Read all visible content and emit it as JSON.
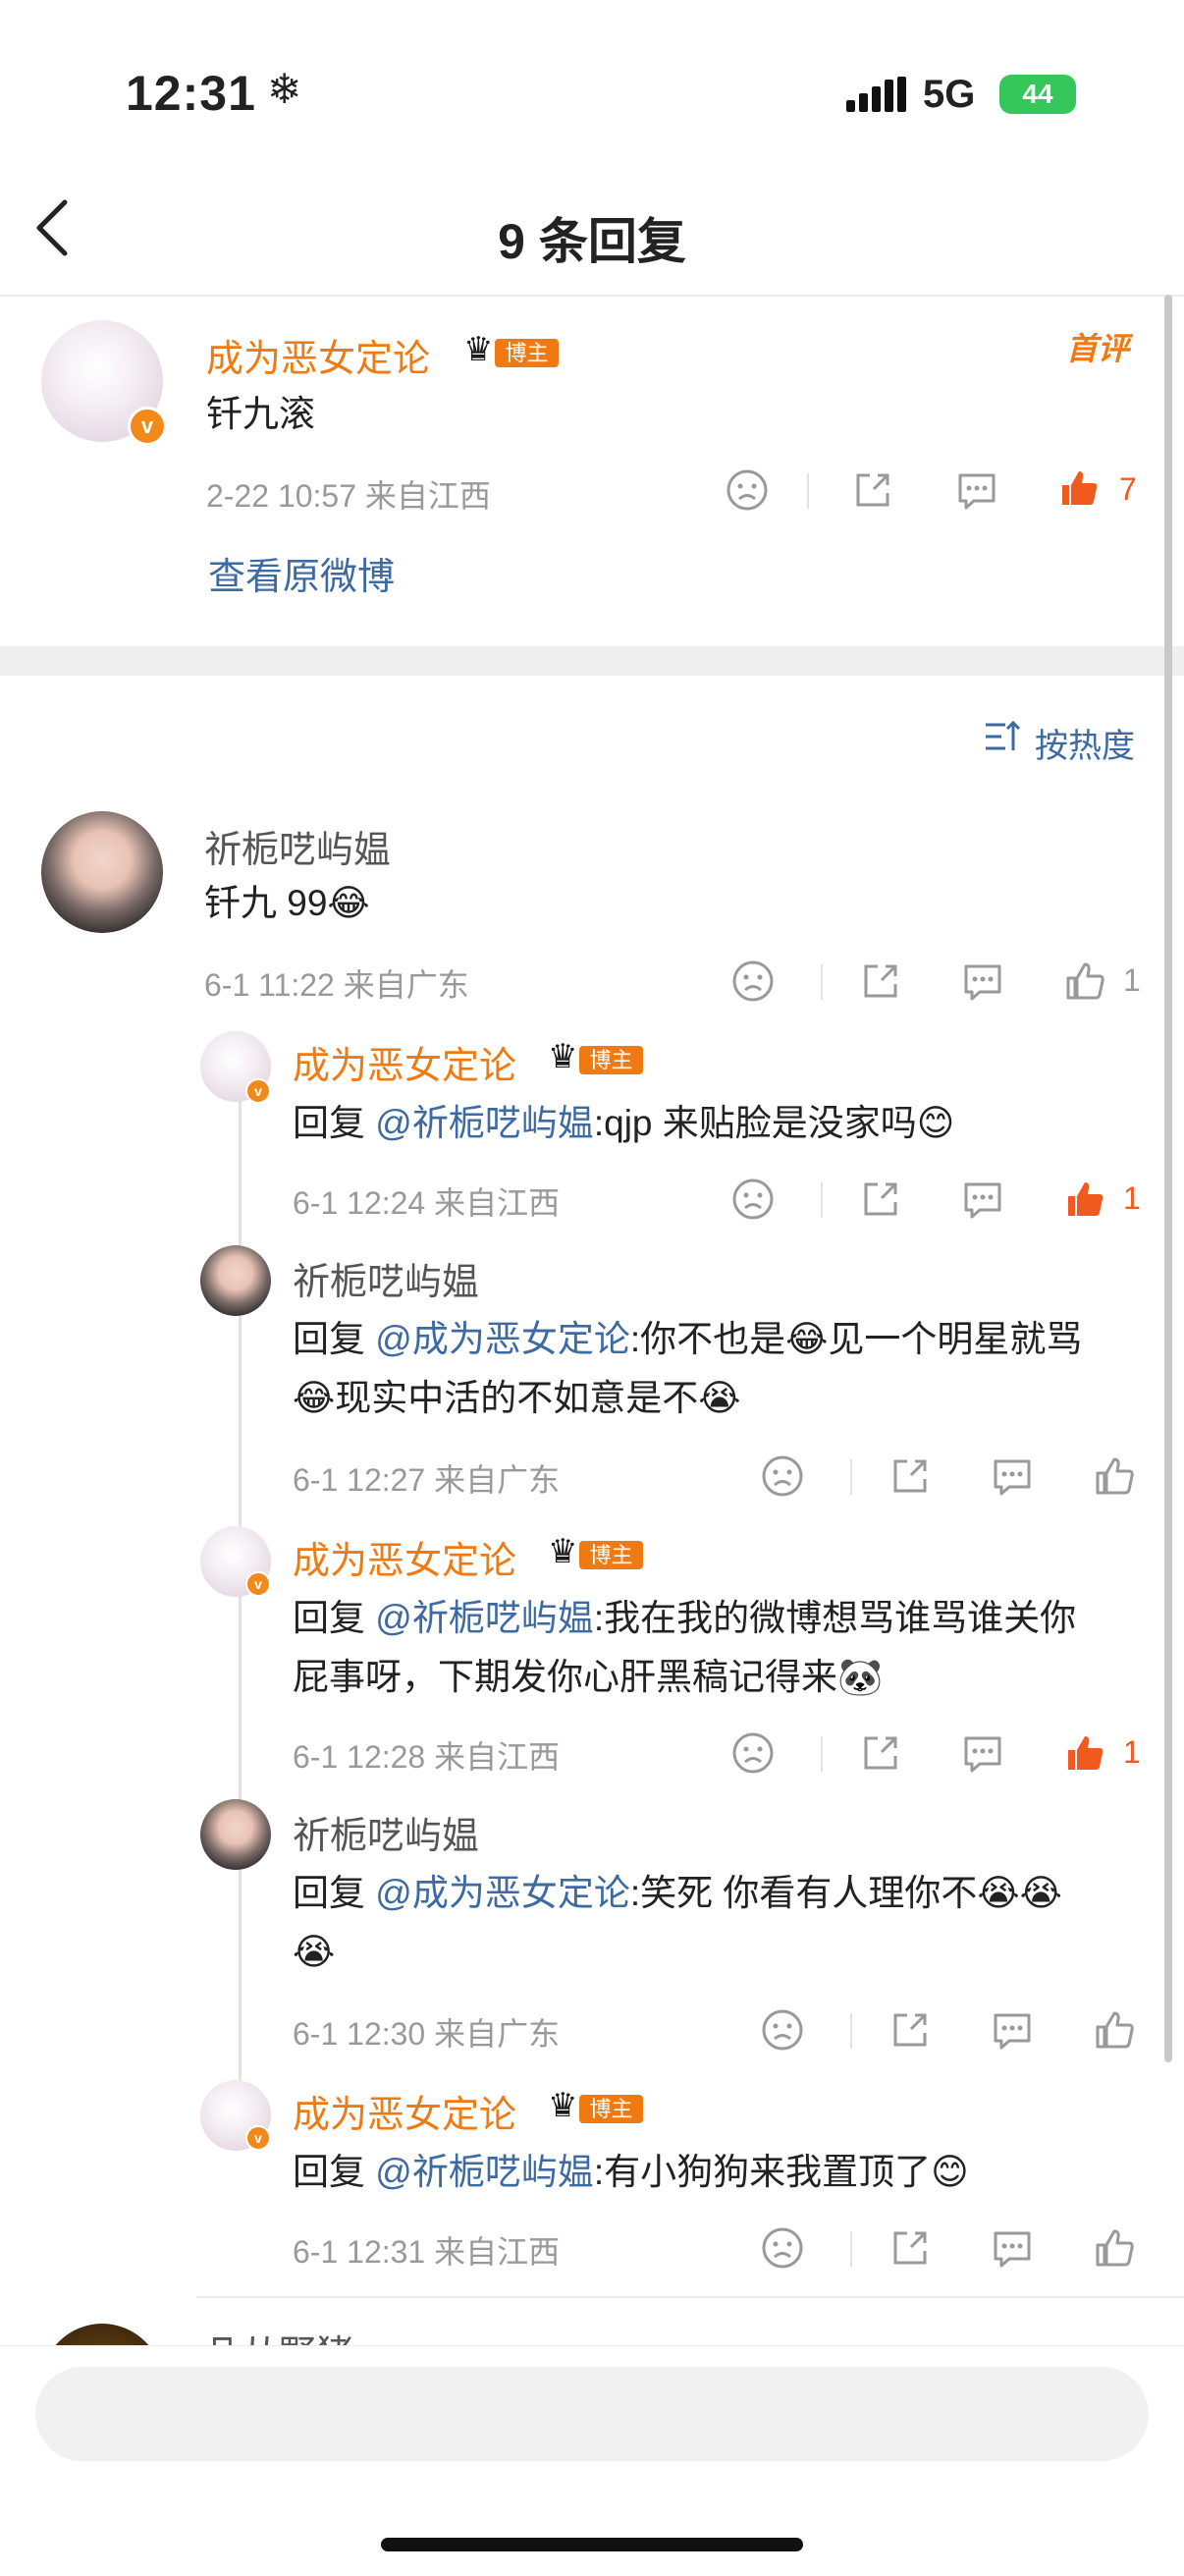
{
  "status_bar": {
    "time": "12:31",
    "time_icon": "❄",
    "network": "5G",
    "battery": "44"
  },
  "nav": {
    "title": "9 条回复",
    "back_icon": "chevron-left-icon"
  },
  "main_comment": {
    "author": "成为恶女定论",
    "badge": "博主",
    "first_tag": "首评",
    "text": "钎九滚",
    "meta": "2-22 10:57 来自江西",
    "likes": "7",
    "view_original": "查看原微博"
  },
  "sort_label": "按热度",
  "replies": [
    {
      "author": "祈栀呓屿媪",
      "text": "钎九 99😂",
      "meta": "6-1 11:22 来自广东",
      "likes": "1"
    },
    {
      "author": "成为恶女定论",
      "badge": "博主",
      "prefix": "回复 ",
      "mention": "@祈栀呓屿媪",
      "text": ":qjp 来贴脸是没家吗😊",
      "meta": "6-1 12:24 来自江西",
      "likes": "1"
    },
    {
      "author": "祈栀呓屿媪",
      "prefix": "回复 ",
      "mention": "@成为恶女定论",
      "text": ":你不也是😂见一个明星就骂",
      "text2": "😂现实中活的不如意是不😭",
      "meta": "6-1 12:27 来自广东",
      "likes": ""
    },
    {
      "author": "成为恶女定论",
      "badge": "博主",
      "prefix": "回复 ",
      "mention": "@祈栀呓屿媪",
      "text": ":我在我的微博想骂谁骂谁关你",
      "text2": "屁事呀，下期发你心肝黑稿记得来🐼",
      "meta": "6-1 12:28 来自江西",
      "likes": "1"
    },
    {
      "author": "祈栀呓屿媪",
      "prefix": "回复 ",
      "mention": "@成为恶女定论",
      "text": ":笑死 你看有人理你不😭😭",
      "text2": "😭",
      "meta": "6-1 12:30 来自广东",
      "likes": ""
    },
    {
      "author": "成为恶女定论",
      "badge": "博主",
      "prefix": "回复 ",
      "mention": "@祈栀呓屿媪",
      "text": ":有小狗狗来我置顶了😊",
      "meta": "6-1 12:31 来自江西",
      "likes": ""
    }
  ],
  "next_author_partial": "凡从野猪",
  "colors": {
    "accent_orange": "#f07a12",
    "mention_blue": "#3d6aa3",
    "like_red": "#f05a1e"
  }
}
